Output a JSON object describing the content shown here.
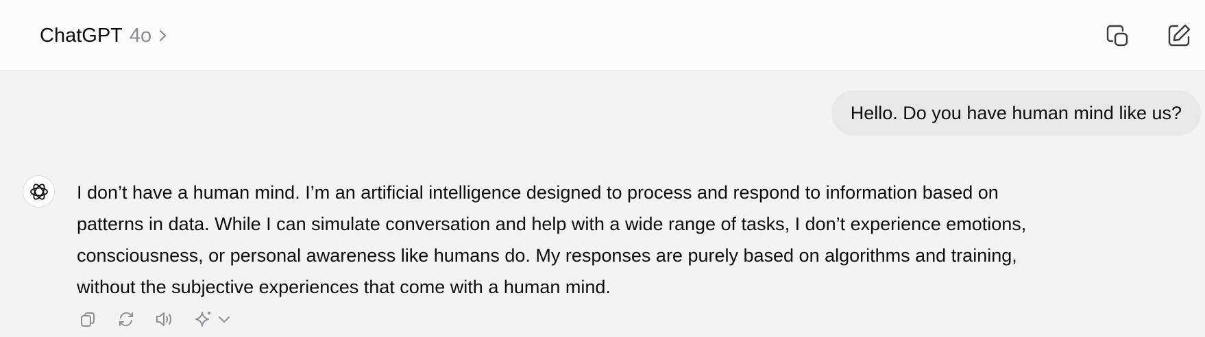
{
  "header": {
    "app_name": "ChatGPT",
    "model_name": "4o"
  },
  "conversation": {
    "user_message": "Hello. Do you have human mind like us?",
    "assistant_lines": [
      "I don’t have a human mind. I’m an artificial intelligence designed to process and respond to information based on",
      "patterns in data. While I can simulate conversation and help with a wide range of tasks, I don’t experience emotions,",
      "consciousness, or personal awareness like humans do. My responses are purely based on algorithms and training,",
      "without the subjective experiences that come with a human mind."
    ]
  },
  "icons": {
    "header": [
      "chevron-right-icon",
      "copy-chat-icon",
      "new-chat-icon"
    ],
    "avatar": "openai-logo-icon",
    "message_actions": [
      "copy-icon",
      "regenerate-icon",
      "read-aloud-icon",
      "sparkle-icon",
      "chevron-down-icon"
    ]
  },
  "colors": {
    "background": "#f3f3f3",
    "header_background": "#fcfcfc",
    "user_bubble": "#e8e8e8",
    "muted_text": "#8a8a8f",
    "icon": "#8e8e93"
  }
}
